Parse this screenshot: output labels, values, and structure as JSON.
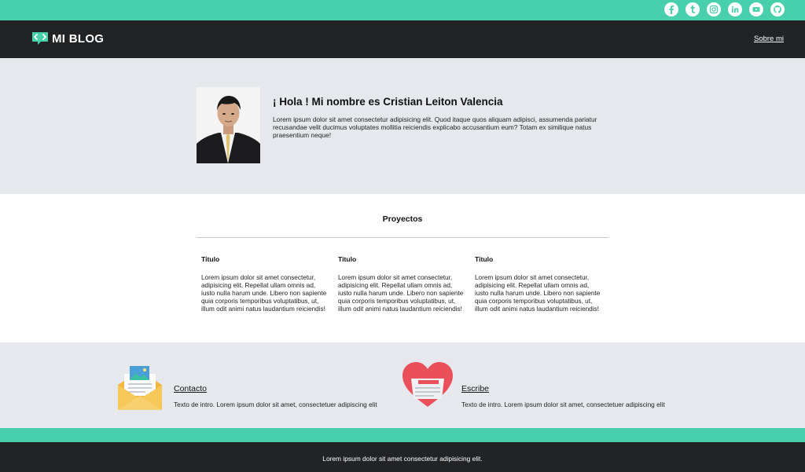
{
  "brand": {
    "name": "MI BLOG",
    "accent": "#48cfab",
    "dark": "#222325",
    "light_bg": "#e6e8ed"
  },
  "social": [
    {
      "icon": "facebook-icon"
    },
    {
      "icon": "tumblr-icon"
    },
    {
      "icon": "instagram-icon"
    },
    {
      "icon": "linkedin-icon"
    },
    {
      "icon": "youtube-icon"
    },
    {
      "icon": "github-icon"
    }
  ],
  "nav": {
    "about": "Sobre mi"
  },
  "hero": {
    "title": "¡ Hola ! Mi nombre es Cristian Leiton Valencia",
    "text": "Lorem ipsum dolor sit amet consectetur adipisicing elit. Quod itaque quos aliquam adipisci, assumenda pariatur recusandae velit ducimus voluptates mollitia reiciendis explicabo accusantium eum? Totam ex similique natus praesentium neque!"
  },
  "projects": {
    "title": "Proyectos",
    "cards": [
      {
        "title": "Titulo",
        "text": "Lorem ipsum dolor sit amet consectetur, adipisicing elit. Repellat ullam omnis ad, iusto nulla harum unde. Libero non sapiente quia corporis temporibus voluptatibus, ut, illum odit animi natus laudantium reiciendis!"
      },
      {
        "title": "Titulo",
        "text": "Lorem ipsum dolor sit amet consectetur, adipisicing elit. Repellat ullam omnis ad, iusto nulla harum unde. Libero non sapiente quia corporis temporibus voluptatibus, ut, illum odit animi natus laudantium reiciendis!"
      },
      {
        "title": "Titulo",
        "text": "Lorem ipsum dolor sit amet consectetur, adipisicing elit. Repellat ullam omnis ad, iusto nulla harum unde. Libero non sapiente quia corporis temporibus voluptatibus, ut, illum odit animi natus laudantium reiciendis!"
      }
    ]
  },
  "contact": {
    "items": [
      {
        "label": "Contacto",
        "text": "Texto de intro. Lorem ipsum dolor sit amet, consectetuer adipiscing elit",
        "icon": "envelope-icon"
      },
      {
        "label": "Escribe",
        "text": "Texto de intro. Lorem ipsum dolor sit amet, consectetuer adipiscing elit",
        "icon": "heart-letter-icon"
      }
    ]
  },
  "footer": {
    "text": "Lorem ipsum dolor sit amet consectetur adipisicing elit."
  }
}
